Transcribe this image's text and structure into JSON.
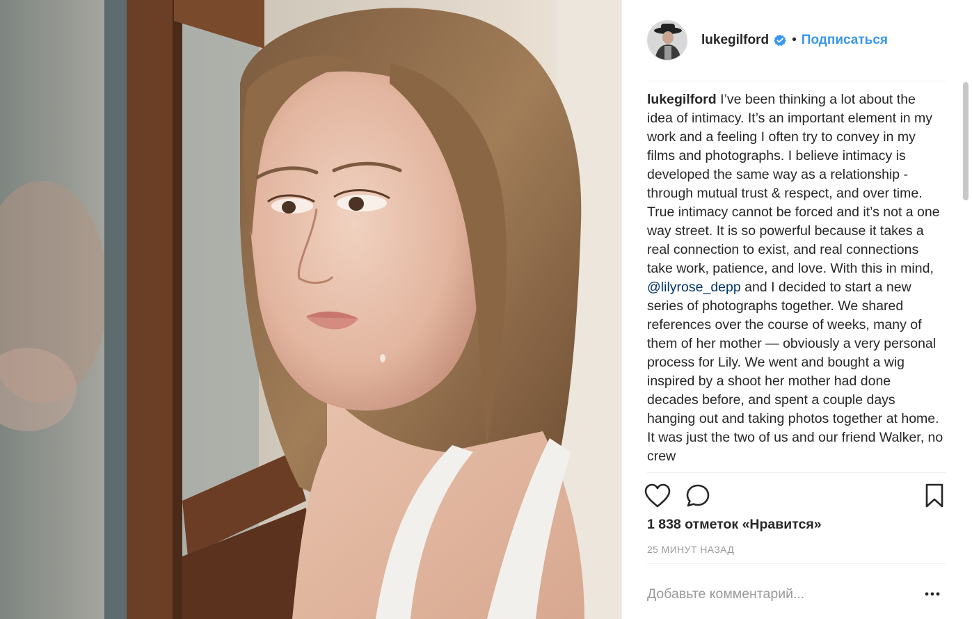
{
  "post": {
    "photo": {
      "alt": "",
      "image_icon": "portrait-photo"
    },
    "author": {
      "username": "lukegilford",
      "verified": true,
      "verified_icon": "verified-badge-icon",
      "separator": "•",
      "follow_label": "Подписаться"
    },
    "caption": {
      "username": "lukegilford",
      "text_before_mention": " I’ve been thinking a lot about the idea of intimacy. It’s an important element in my work and a feeling I often try to convey in my films and photographs. I believe intimacy is developed the same way as a relationship - through mutual trust & respect, and over time. True intimacy cannot be forced and it’s not a one way street. It is so powerful because it takes a real connection to exist, and real connections take work, patience, and love. With this in mind, ",
      "mention": "@lilyrose_depp",
      "text_after_mention": " and I decided to start a new series of photographs together. We shared references over the course of weeks, many of them of her mother — obviously a very personal process for Lily. We went and bought a wig inspired by a shoot her mother had done decades before, and spent a couple days hanging out and taking photos together at home. It was just the two of us and our friend Walker, no crew"
    },
    "actions": {
      "like_icon": "heart-icon",
      "comment_icon": "comment-bubble-icon",
      "save_icon": "bookmark-icon"
    },
    "likes_text": "1 838 отметок «Нравится»",
    "timestamp": "25 МИНУТ НАЗАД",
    "comment": {
      "placeholder": "Добавьте комментарий...",
      "more_icon": "more-options-icon"
    },
    "colors": {
      "link_blue": "#3897f0",
      "mention_blue": "#003569",
      "text": "#262626",
      "muted": "#999999",
      "divider": "#efefef"
    }
  }
}
